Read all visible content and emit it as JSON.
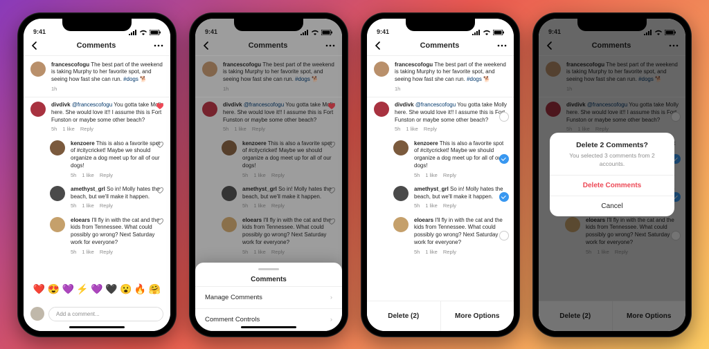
{
  "statusbar": {
    "time": "9:41"
  },
  "navbar": {
    "title": "Comments"
  },
  "post": {
    "username": "francescofogu",
    "text": "The best part of the weekend is taking Murphy to her favorite spot, and seeing how fast she can run.",
    "hashtag": "#dogs",
    "emoji": "🐕",
    "time": "1h"
  },
  "comments": [
    {
      "username": "divdivk",
      "mention": "@francescofogu",
      "text": "You gotta take Molly here. She would love it!! I assume this is Fort Funston or maybe some other beach?",
      "time": "5h",
      "likes": "1 like",
      "reply_label": "Reply",
      "liked": true
    },
    {
      "reply": true,
      "username": "kenzoere",
      "text": "This is also a favorite spot of #citycricket! Maybe we should organize a dog meet up for all of our dogs!",
      "time": "5h",
      "likes": "1 like",
      "reply_label": "Reply"
    },
    {
      "reply": true,
      "username": "amethyst_grl",
      "text": "So in! Molly hates the beach, but we'll make it happen.",
      "time": "5h",
      "likes": "1 like",
      "reply_label": "Reply"
    },
    {
      "reply": true,
      "username": "eloears",
      "text": "I'll fly in with the cat and the kids from Tennessee. What could possibly go wrong? Next Saturday work for everyone?",
      "time": "5h",
      "likes": "1 like",
      "reply_label": "Reply"
    }
  ],
  "emoji_bar": [
    "❤️",
    "😍",
    "💜",
    "⚡",
    "💜",
    "🖤",
    "😮",
    "🔥",
    "🤗"
  ],
  "compose": {
    "placeholder": "Add a comment..."
  },
  "sheet": {
    "title": "Comments",
    "rows": [
      "Manage Comments",
      "Comment Controls"
    ]
  },
  "multiselect": {
    "delete_label": "Delete (2)",
    "more_label": "More Options"
  },
  "alert": {
    "title": "Delete 2 Comments?",
    "message": "You selected 3 comments from 2 accounts.",
    "delete": "Delete Comments",
    "cancel": "Cancel"
  },
  "avatar_colors": {
    "post": "#b9906b",
    "c0": "#a83240",
    "c1": "#7b5a3d",
    "c2": "#4a4a4a",
    "c3": "#c5a06b",
    "compose": "#c0b8aa"
  }
}
